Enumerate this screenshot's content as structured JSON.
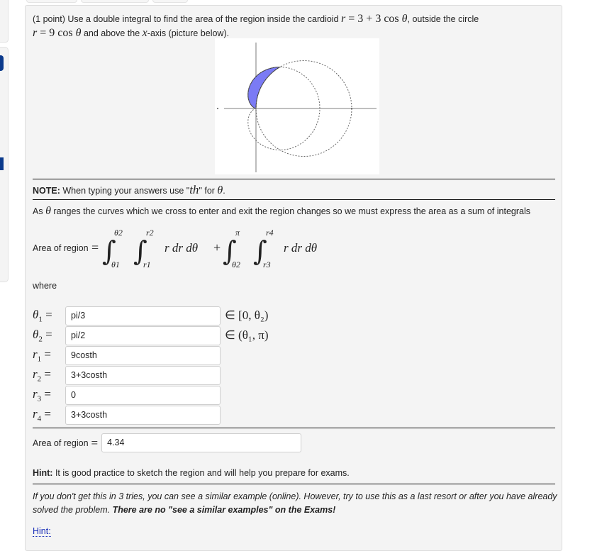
{
  "problem": {
    "points_label": "(1 point)",
    "statement_a": "Use a double integral to find the area of the region inside the cardioid",
    "cardioid_eq": "r = 3 + 3 cos θ",
    "statement_b": ", outside the circle",
    "circle_eq": "r = 9 cos θ",
    "statement_c": "and above the",
    "axis_var": "x",
    "statement_d": "-axis (picture below)."
  },
  "figure": {
    "description": "cardioid r=3+3cosθ and circle r=9cosθ with shaded region above x-axis",
    "fill_color": "#7b7bf5",
    "curve_style": "dashed",
    "axis_color": "#999999"
  },
  "note": {
    "label": "NOTE:",
    "text_a": "When typing your answers use \"",
    "th": "th",
    "text_b": "\" for",
    "theta": "θ",
    "text_c": "."
  },
  "explanation": {
    "text_a": "As",
    "theta": "θ",
    "text_b": "ranges the curves which we cross to enter and exit the region changes so we must express the area as a sum of integrals"
  },
  "formula": {
    "label": "Area of region",
    "eq": "=",
    "first": {
      "outer_lower": "θ1",
      "outer_upper": "θ2",
      "inner_lower": "r1",
      "inner_upper": "r2"
    },
    "second": {
      "outer_lower": "θ2",
      "outer_upper": "π",
      "inner_lower": "r3",
      "inner_upper": "r4"
    },
    "integrand": "r dr dθ",
    "plus": "+"
  },
  "where_label": "where",
  "fields": [
    {
      "symbol": "θ",
      "sub": "1",
      "value": "pi/3",
      "range": "∈ [0, θ₂)"
    },
    {
      "symbol": "θ",
      "sub": "2",
      "value": "pi/2",
      "range": "∈ (θ₁, π)"
    },
    {
      "symbol": "r",
      "sub": "1",
      "value": "9costh",
      "range": ""
    },
    {
      "symbol": "r",
      "sub": "2",
      "value": "3+3costh",
      "range": ""
    },
    {
      "symbol": "r",
      "sub": "3",
      "value": "0",
      "range": ""
    },
    {
      "symbol": "r",
      "sub": "4",
      "value": "3+3costh",
      "range": ""
    }
  ],
  "answer": {
    "label": "Area of region",
    "eq": "=",
    "value": "4.34"
  },
  "hint_text": {
    "label": "Hint:",
    "text": "It is good practice to sketch the region and will help you prepare for exams."
  },
  "similar": {
    "text": "If you don't get this in 3 tries, you can see a similar example (online). However, try to use this as a last resort or after you have already solved the problem.",
    "bold": "There are no \"see a similar examples\" on the Exams!"
  },
  "hint_link": "Hint:"
}
